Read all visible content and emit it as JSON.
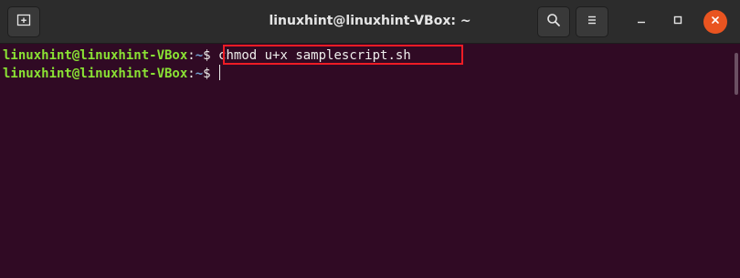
{
  "window": {
    "title": "linuxhint@linuxhint-VBox: ~"
  },
  "header": {
    "new_tab_icon": "new-tab-icon",
    "search_icon": "search-icon",
    "menu_icon": "hamburger-menu-icon",
    "minimize_icon": "minimize-icon",
    "maximize_icon": "maximize-icon",
    "close_icon": "close-icon"
  },
  "terminal": {
    "lines": [
      {
        "user_host": "linuxhint@linuxhint-VBox",
        "colon": ":",
        "path": "~",
        "prompt": "$ ",
        "command": "chmod u+x samplescript.sh"
      },
      {
        "user_host": "linuxhint@linuxhint-VBox",
        "colon": ":",
        "path": "~",
        "prompt": "$ ",
        "command": ""
      }
    ]
  },
  "colors": {
    "background": "#300a24",
    "user_host": "#8ae234",
    "path": "#729fcf",
    "highlight_border": "#ee1c25",
    "close_button": "#e95420"
  }
}
